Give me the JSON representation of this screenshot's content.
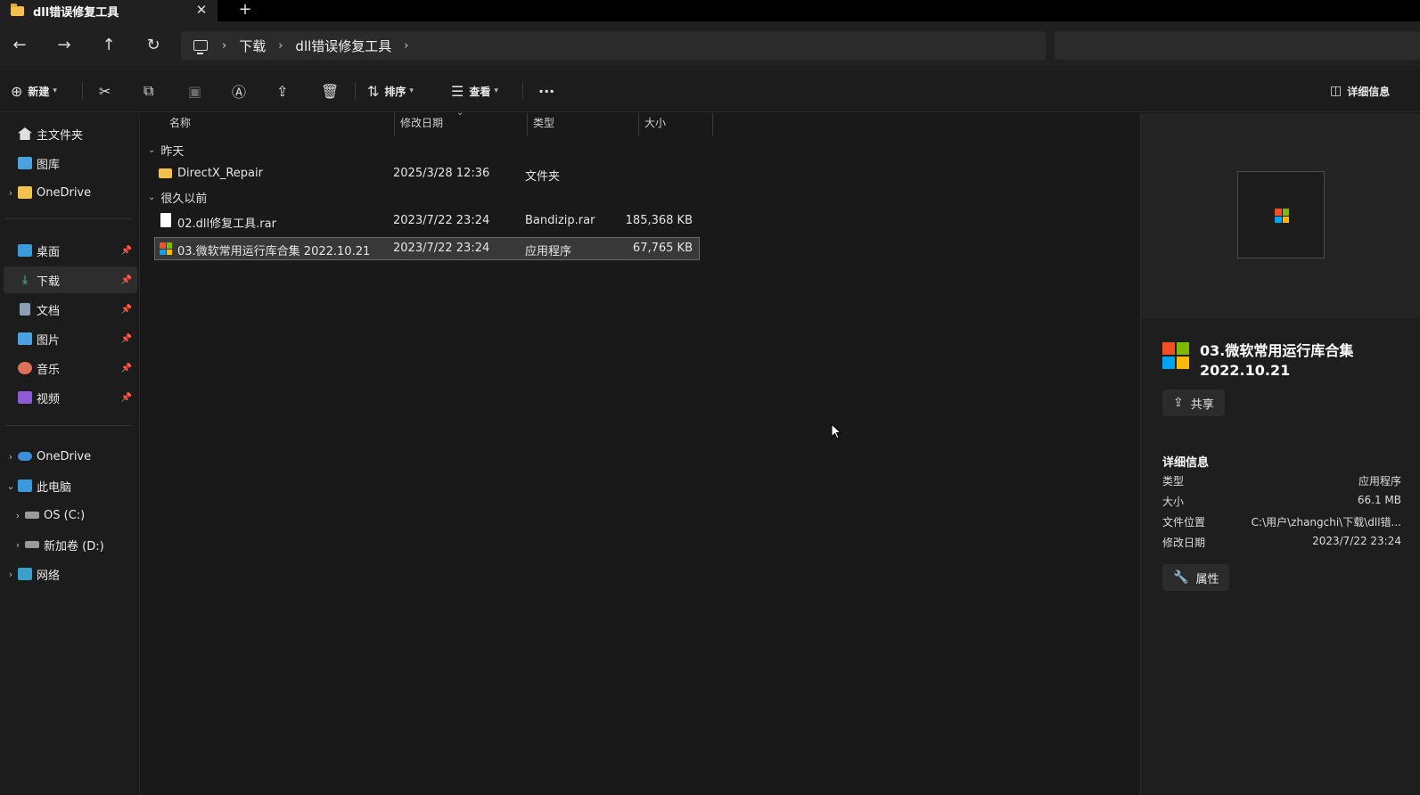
{
  "tab": {
    "title": "dll错误修复工具",
    "close": "✕",
    "new_tab": "+"
  },
  "nav": {
    "back": "←",
    "forward": "→",
    "up": "↑",
    "refresh": "↻",
    "breadcrumb": [
      "下载",
      "dll错误修复工具"
    ]
  },
  "toolbar": {
    "new_label": "新建",
    "sort_label": "排序",
    "view_label": "查看",
    "more": "···",
    "details_label": "详细信息"
  },
  "sidebar": {
    "top": [
      {
        "label": "主文件夹",
        "icon": "home-icon"
      },
      {
        "label": "图库",
        "icon": "gallery-icon"
      },
      {
        "label": "OneDrive",
        "icon": "folder-icon"
      }
    ],
    "pinned": [
      {
        "label": "桌面",
        "icon": "desktop-icon"
      },
      {
        "label": "下载",
        "icon": "download-icon"
      },
      {
        "label": "文档",
        "icon": "document-icon"
      },
      {
        "label": "图片",
        "icon": "pictures-icon"
      },
      {
        "label": "音乐",
        "icon": "music-icon"
      },
      {
        "label": "视频",
        "icon": "video-icon"
      }
    ],
    "tree": [
      {
        "label": "OneDrive",
        "icon": "cloud-icon"
      },
      {
        "label": "此电脑",
        "icon": "pc-icon"
      },
      {
        "label": "OS (C:)",
        "icon": "drive-icon"
      },
      {
        "label": "新加卷 (D:)",
        "icon": "drive-icon"
      },
      {
        "label": "网络",
        "icon": "network-icon"
      }
    ]
  },
  "columns": {
    "name": "名称",
    "modified": "修改日期",
    "type": "类型",
    "size": "大小"
  },
  "groups": [
    {
      "label": "昨天",
      "files": [
        {
          "name": "DirectX_Repair",
          "modified": "2025/3/28 12:36",
          "type": "文件夹",
          "size": ""
        }
      ]
    },
    {
      "label": "很久以前",
      "files": [
        {
          "name": "02.dll修复工具.rar",
          "modified": "2023/7/22 23:24",
          "type": "Bandizip.rar",
          "size": "185,368 KB"
        },
        {
          "name": "03.微软常用运行库合集 2022.10.21",
          "modified": "2023/7/22 23:24",
          "type": "应用程序",
          "size": "67,765 KB"
        }
      ]
    }
  ],
  "details": {
    "title_line1": "03.微软常用运行库合集",
    "title_line2": "2022.10.21",
    "share_label": "共享",
    "section_title": "详细信息",
    "props": [
      {
        "key": "类型",
        "value": "应用程序"
      },
      {
        "key": "大小",
        "value": "66.1 MB"
      },
      {
        "key": "文件位置",
        "value": "C:\\用户\\zhangchi\\下载\\dll错..."
      },
      {
        "key": "修改日期",
        "value": "2023/7/22 23:24"
      }
    ],
    "properties_label": "属性"
  },
  "colors": {
    "accent_folder": "#f2c14e",
    "bg": "#191919",
    "selected": "#383838"
  }
}
